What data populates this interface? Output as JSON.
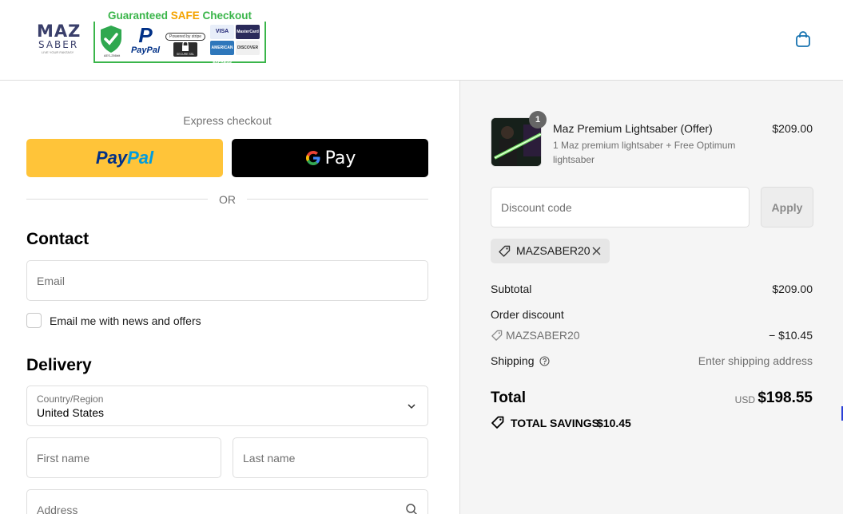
{
  "header": {
    "logo": {
      "line1": "MAZ",
      "line2": "SABER",
      "tagline": "LIVE YOUR FANTASY"
    },
    "trust_badge": {
      "title_pre": "Guaranteed ",
      "title_safe": "SAFE",
      "title_post": " Checkout",
      "shield_label": "AES-256bit",
      "paypal_label": "PayPal",
      "stripe_label": "Powered by stripe",
      "lock_label": "SECURE SSL",
      "cards": [
        "VISA",
        "MasterCard",
        "AMERICAN EXPRESS",
        "DISCOVER"
      ]
    },
    "cart_icon": "shopping-bag-icon"
  },
  "express": {
    "label": "Express checkout",
    "paypal_label_a": "Pay",
    "paypal_label_b": "Pal",
    "gpay_label": "Pay",
    "divider": "OR"
  },
  "contact": {
    "heading": "Contact",
    "email_placeholder": "Email",
    "newsletter_label": "Email me with news and offers"
  },
  "delivery": {
    "heading": "Delivery",
    "country_label": "Country/Region",
    "country_value": "United States",
    "first_name_placeholder": "First name",
    "last_name_placeholder": "Last name",
    "address_placeholder": "Address"
  },
  "summary": {
    "product": {
      "quantity": "1",
      "title": "Maz Premium Lightsaber (Offer)",
      "description": "1 Maz premium lightsaber + Free Optimum lightsaber",
      "price": "$209.00"
    },
    "discount_placeholder": "Discount code",
    "apply_label": "Apply",
    "applied_code": "MAZSABER20",
    "subtotal_label": "Subtotal",
    "subtotal_value": "$209.00",
    "order_discount_label": "Order discount",
    "discount_code": "MAZSABER20",
    "discount_value": "− $10.45",
    "shipping_label": "Shipping",
    "shipping_value": "Enter shipping address",
    "total_label": "Total",
    "currency": "USD",
    "total_value": "$198.55",
    "savings_label": "TOTAL SAVINGS",
    "savings_value": "$10.45"
  },
  "colors": {
    "paypal_yellow": "#ffc439",
    "badge_green": "#3ab54a",
    "summary_bg": "#f5f5f5"
  }
}
